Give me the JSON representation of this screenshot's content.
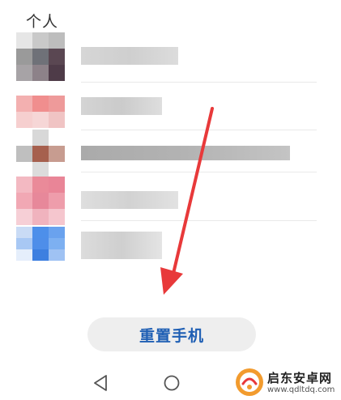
{
  "section": {
    "header": "个人"
  },
  "contacts": [
    {
      "avatar_colors": [
        "#e6e6e6",
        "#c9c9c9",
        "#bdbdbd",
        "#9a9a9a",
        "#6f7178",
        "#5a4752",
        "#a7a3a6",
        "#8d8289",
        "#4e3b48"
      ],
      "bars": [
        "#d6d6d6",
        "#cfcfcf",
        "#dcdcdc"
      ]
    },
    {
      "avatar_colors": [
        "#f3b0b0",
        "#f08e8e",
        "#ee9a9a",
        "#f6cfcf",
        "#f6d6d6",
        "#f0c4c4",
        "#ffffff",
        "#ffffff",
        "#ffffff"
      ],
      "bars": [
        "#d4d4d4",
        "#cbcbcb",
        "#dedede"
      ]
    },
    {
      "avatar_colors": [
        "#ffffff",
        "#d8d8d8",
        "#ffffff",
        "#bfbfbf",
        "#a6604e",
        "#c79c90",
        "#ffffff",
        "#dcdcdc",
        "#ffffff"
      ],
      "bars": [
        "#aaaaaa",
        "#b3b3b3",
        "#c4c4c4"
      ]
    },
    {
      "avatar_colors": [
        "#f3b9c2",
        "#ea8a99",
        "#e98597",
        "#f1a8b4",
        "#e7889a",
        "#ee9dab",
        "#f6cfd6",
        "#f0b3be",
        "#f5c6ce"
      ],
      "bars": [
        "#dedede",
        "#d2d2d2",
        "#e2e2e2"
      ]
    },
    {
      "avatar_colors": [
        "#c9dbf5",
        "#4d8fea",
        "#6aa2ee",
        "#a8c8f4",
        "#4e8ee9",
        "#7db0f1",
        "#e5eefb",
        "#3d7fe0",
        "#9fc2f3"
      ],
      "bars": [
        "#dcdcdc",
        "#cfcfcf",
        "#e4e4e4"
      ]
    }
  ],
  "reset_button": {
    "label": "重置手机"
  },
  "colors": {
    "accent": "#1f5fb4",
    "arrow": "#e8393a"
  },
  "nav": {
    "back_icon": "triangle-back-icon",
    "home_icon": "circle-home-icon"
  },
  "watermark": {
    "title": "启东安卓网",
    "url": "www.qdltdq.com"
  }
}
